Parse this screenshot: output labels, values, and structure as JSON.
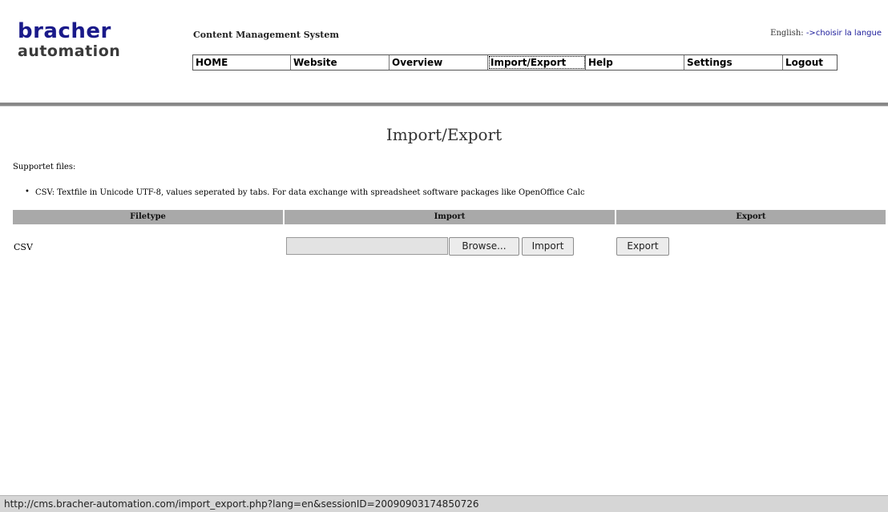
{
  "logo": {
    "line1": "bracher",
    "line2": "automation"
  },
  "header": {
    "cms_title": "Content Management System",
    "language_current": "English:",
    "language_link": "->choisir la langue"
  },
  "nav": {
    "items": [
      "HOME",
      "Website",
      "Overview",
      "Import/Export",
      "Help",
      "Settings",
      "Logout"
    ],
    "active": "Import/Export"
  },
  "main": {
    "heading": "Import/Export",
    "supported_label": "Supportet files:",
    "supported_items": [
      "CSV: Textfile in Unicode UTF-8, values seperated by tabs. For data exchange with spreadsheet software packages like OpenOffice Calc"
    ]
  },
  "table": {
    "headers": [
      "Filetype",
      "Import",
      "Export"
    ],
    "rows": [
      {
        "filetype": "CSV",
        "browse_label": "Browse...",
        "import_label": "Import",
        "export_label": "Export"
      }
    ]
  },
  "statusbar": {
    "url": "http://cms.bracher-automation.com/import_export.php?lang=en&sessionID=20090903174850726"
  },
  "colors": {
    "logo_blue": "#1a1a8a",
    "link_blue": "#1a1a9a",
    "table_header_bg": "#a9a9a9",
    "rule_gray": "#888888"
  }
}
